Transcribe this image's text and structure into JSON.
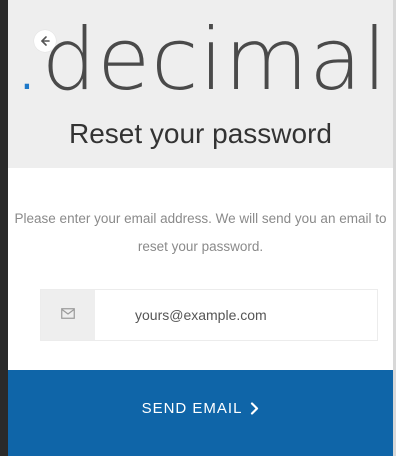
{
  "header": {
    "back_icon": "arrow-left-icon",
    "logo": {
      "dot": ".",
      "word": "decimal"
    },
    "title": "Reset your password"
  },
  "form": {
    "instructions": "Please enter your email address. We will send you an email to reset your password.",
    "email_icon": "envelope-icon",
    "email_placeholder": "yours@example.com",
    "email_value": ""
  },
  "submit": {
    "label": "SEND EMAIL",
    "icon": "chevron-right-icon"
  },
  "colors": {
    "brand_blue": "#0f65a8",
    "logo_dot": "#1d78c8",
    "logo_text": "#4a4a4a",
    "header_bg": "#eeeeee"
  }
}
